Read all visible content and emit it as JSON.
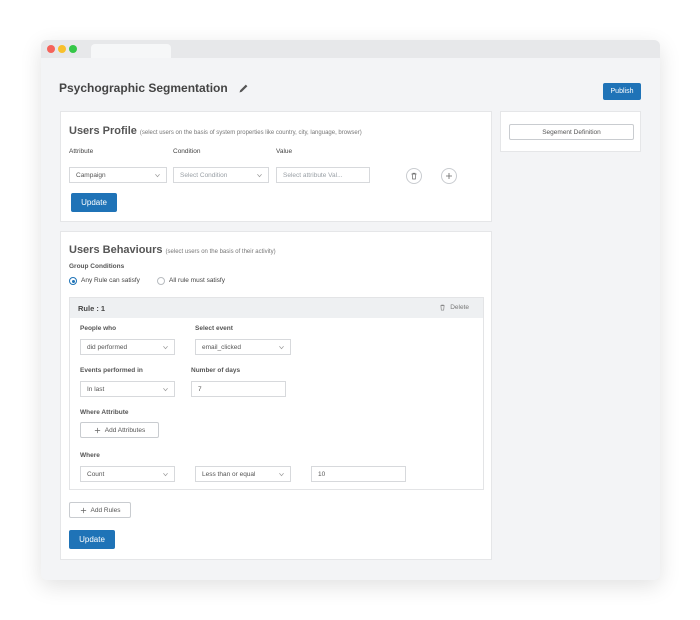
{
  "page": {
    "title": "Psychographic Segmentation",
    "publish_label": "Publish"
  },
  "side": {
    "segment_definition_label": "Segement Definition"
  },
  "users_profile": {
    "title": "Users Profile",
    "subtitle": "(select users on the basis of system properties like country, city, language, browser)",
    "attribute_header": "Attribute",
    "condition_header": "Condition",
    "value_header": "Value",
    "attribute_value": "Campaign",
    "condition_placeholder": "Select Condition",
    "value_placeholder": "Select attribute Val...",
    "update_label": "Update"
  },
  "users_behaviours": {
    "title": "Users Behaviours",
    "subtitle": "(select users on the basis of their activity)",
    "group_conditions_label": "Group Conditions",
    "radio_any": "Any Rule can satisfy",
    "radio_all": "All rule must satisfy",
    "selected_radio": "any",
    "rule": {
      "title": "Rule : 1",
      "delete_label": "Delete",
      "people_who_label": "People who",
      "people_who_value": "did performed",
      "select_event_label": "Select event",
      "select_event_value": "email_clicked",
      "events_performed_label": "Events performed in",
      "events_performed_value": "In last",
      "number_of_days_label": "Number of days",
      "number_of_days_value": "7",
      "where_attribute_label": "Where Attribute",
      "add_attributes_label": "Add Attributes",
      "where_label": "Where",
      "where_field_value": "Count",
      "where_operator_value": "Less than or equal",
      "where_input_value": "10"
    },
    "add_rules_label": "Add Rules",
    "update_label": "Update"
  },
  "colors": {
    "accent": "#1f73b7",
    "window_bg": "#f3f4f6",
    "panel_border": "#e5e6e8"
  }
}
